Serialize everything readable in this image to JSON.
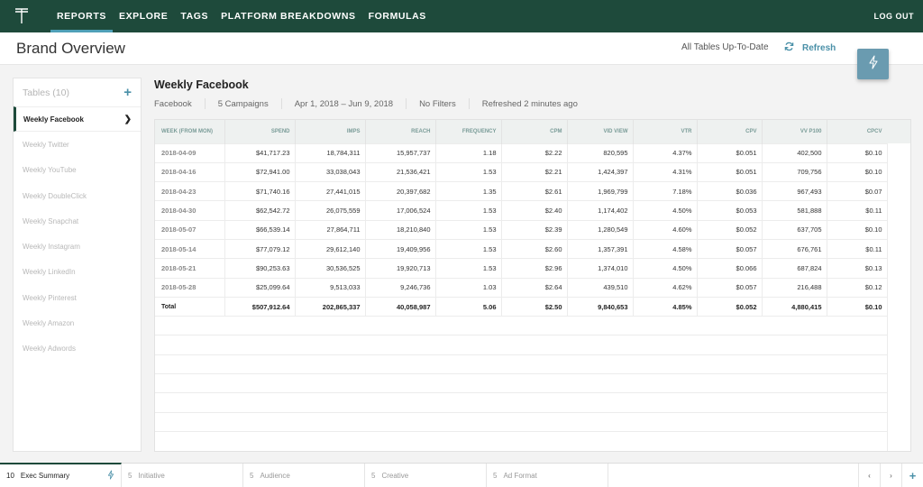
{
  "nav": {
    "tabs": [
      {
        "label": "REPORTS",
        "active": true
      },
      {
        "label": "EXPLORE"
      },
      {
        "label": "TAGS"
      },
      {
        "label": "PLATFORM BREAKDOWNS"
      },
      {
        "label": "FORMULAS"
      }
    ],
    "logout": "LOG OUT"
  },
  "header": {
    "title": "Brand Overview",
    "status": "All Tables Up-To-Date",
    "refresh": "Refresh"
  },
  "sidebar": {
    "title": "Tables (10)",
    "add": "+",
    "items": [
      {
        "label": "Weekly Facebook",
        "active": true
      },
      {
        "label": "Weekly Twitter"
      },
      {
        "label": "Weekly YouTube"
      },
      {
        "label": "Weekly DoubleClick"
      },
      {
        "label": "Weekly Snapchat"
      },
      {
        "label": "Weekly Instagram"
      },
      {
        "label": "Weekly LinkedIn"
      },
      {
        "label": "Weekly Pinterest"
      },
      {
        "label": "Weekly Amazon"
      },
      {
        "label": "Weekly Adwords"
      }
    ]
  },
  "report": {
    "title": "Weekly Facebook",
    "filters": [
      "Facebook",
      "5 Campaigns",
      "Apr 1, 2018 – Jun 9, 2018",
      "No Filters",
      "Refreshed 2 minutes ago"
    ],
    "columns": [
      "WEEK (FROM MON)",
      "SPEND",
      "IMPS",
      "REACH",
      "FREQUENCY",
      "CPM",
      "VID VIEW",
      "VTR",
      "CPV",
      "VV P100",
      "CPCV"
    ],
    "rows": [
      [
        "2018-04-09",
        "$41,717.23",
        "18,784,311",
        "15,957,737",
        "1.18",
        "$2.22",
        "820,595",
        "4.37%",
        "$0.051",
        "402,500",
        "$0.10"
      ],
      [
        "2018-04-16",
        "$72,941.00",
        "33,038,043",
        "21,536,421",
        "1.53",
        "$2.21",
        "1,424,397",
        "4.31%",
        "$0.051",
        "709,756",
        "$0.10"
      ],
      [
        "2018-04-23",
        "$71,740.16",
        "27,441,015",
        "20,397,682",
        "1.35",
        "$2.61",
        "1,969,799",
        "7.18%",
        "$0.036",
        "967,493",
        "$0.07"
      ],
      [
        "2018-04-30",
        "$62,542.72",
        "26,075,559",
        "17,006,524",
        "1.53",
        "$2.40",
        "1,174,402",
        "4.50%",
        "$0.053",
        "581,888",
        "$0.11"
      ],
      [
        "2018-05-07",
        "$66,539.14",
        "27,864,711",
        "18,210,840",
        "1.53",
        "$2.39",
        "1,280,549",
        "4.60%",
        "$0.052",
        "637,705",
        "$0.10"
      ],
      [
        "2018-05-14",
        "$77,079.12",
        "29,612,140",
        "19,409,956",
        "1.53",
        "$2.60",
        "1,357,391",
        "4.58%",
        "$0.057",
        "676,761",
        "$0.11"
      ],
      [
        "2018-05-21",
        "$90,253.63",
        "30,536,525",
        "19,920,713",
        "1.53",
        "$2.96",
        "1,374,010",
        "4.50%",
        "$0.066",
        "687,824",
        "$0.13"
      ],
      [
        "2018-05-28",
        "$25,099.64",
        "9,513,033",
        "9,246,736",
        "1.03",
        "$2.64",
        "439,510",
        "4.62%",
        "$0.057",
        "216,488",
        "$0.12"
      ]
    ],
    "total": [
      "Total",
      "$507,912.64",
      "202,865,337",
      "40,058,987",
      "5.06",
      "$2.50",
      "9,840,653",
      "4.85%",
      "$0.052",
      "4,880,415",
      "$0.10"
    ]
  },
  "bottom": {
    "tabs": [
      {
        "count": "10",
        "label": "Exec Summary",
        "active": true
      },
      {
        "count": "5",
        "label": "Initiative"
      },
      {
        "count": "5",
        "label": "Audience"
      },
      {
        "count": "5",
        "label": "Creative"
      },
      {
        "count": "5",
        "label": "Ad Format"
      }
    ],
    "prev": "‹",
    "next": "›",
    "add": "+"
  },
  "colors": {
    "nav_bg": "#1e4a3b",
    "accent": "#4a90a8",
    "bolt_bg": "#6a9bb0"
  }
}
